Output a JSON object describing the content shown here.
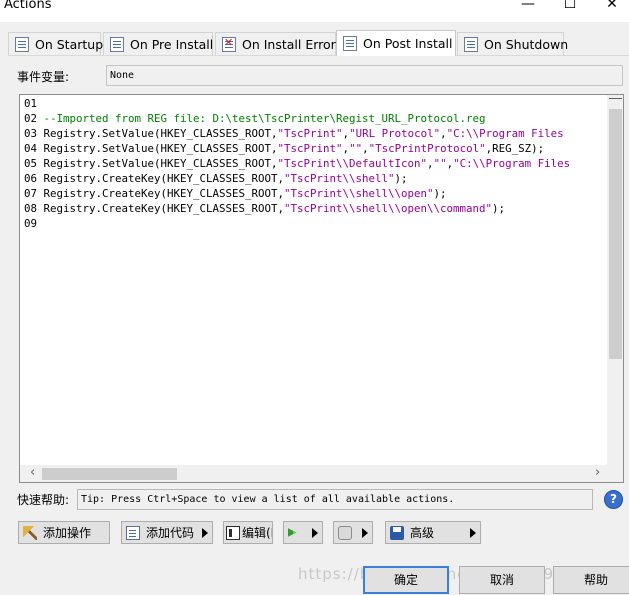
{
  "window": {
    "title": "Actions",
    "minimize_glyph": "—",
    "maximize_glyph": "☐",
    "close_glyph": "✕"
  },
  "tabs": [
    {
      "label": "On Startup",
      "icon": "script-icon",
      "active": false
    },
    {
      "label": "On Pre Install",
      "icon": "script-icon",
      "active": false
    },
    {
      "label": "On Install Error",
      "icon": "script-error-icon",
      "active": false
    },
    {
      "label": "On Post Install",
      "icon": "script-icon",
      "active": true
    },
    {
      "label": "On Shutdown",
      "icon": "script-icon",
      "active": false
    }
  ],
  "event": {
    "label": "事件变量:",
    "value": "None"
  },
  "editor": {
    "lines": [
      {
        "num": "01",
        "parts": []
      },
      {
        "num": "02",
        "parts": [
          {
            "t": "--Imported from REG file: D:\\test\\TscPrinter\\Regist_URL_Protocol.reg",
            "c": "comment"
          }
        ]
      },
      {
        "num": "03",
        "parts": [
          {
            "t": "Registry.SetValue(HKEY_CLASSES_ROOT,",
            "c": "plain"
          },
          {
            "t": "\"TscPrint\"",
            "c": "str"
          },
          {
            "t": ",",
            "c": "plain"
          },
          {
            "t": "\"URL Protocol\"",
            "c": "str"
          },
          {
            "t": ",",
            "c": "plain"
          },
          {
            "t": "\"C:\\\\Program Files",
            "c": "str"
          }
        ]
      },
      {
        "num": "04",
        "parts": [
          {
            "t": "Registry.SetValue(HKEY_CLASSES_ROOT,",
            "c": "plain"
          },
          {
            "t": "\"TscPrint\"",
            "c": "str"
          },
          {
            "t": ",",
            "c": "plain"
          },
          {
            "t": "\"\"",
            "c": "str"
          },
          {
            "t": ",",
            "c": "plain"
          },
          {
            "t": "\"TscPrintProtocol\"",
            "c": "str"
          },
          {
            "t": ",REG_SZ);",
            "c": "plain"
          }
        ]
      },
      {
        "num": "05",
        "parts": [
          {
            "t": "Registry.SetValue(HKEY_CLASSES_ROOT,",
            "c": "plain"
          },
          {
            "t": "\"TscPrint\\\\DefaultIcon\"",
            "c": "str"
          },
          {
            "t": ",",
            "c": "plain"
          },
          {
            "t": "\"\"",
            "c": "str"
          },
          {
            "t": ",",
            "c": "plain"
          },
          {
            "t": "\"C:\\\\Program Files",
            "c": "str"
          }
        ]
      },
      {
        "num": "06",
        "parts": [
          {
            "t": "Registry.CreateKey(HKEY_CLASSES_ROOT,",
            "c": "plain"
          },
          {
            "t": "\"TscPrint\\\\shell\"",
            "c": "str"
          },
          {
            "t": ");",
            "c": "plain"
          }
        ]
      },
      {
        "num": "07",
        "parts": [
          {
            "t": "Registry.CreateKey(HKEY_CLASSES_ROOT,",
            "c": "plain"
          },
          {
            "t": "\"TscPrint\\\\shell\\\\open\"",
            "c": "str"
          },
          {
            "t": ");",
            "c": "plain"
          }
        ]
      },
      {
        "num": "08",
        "parts": [
          {
            "t": "Registry.CreateKey(HKEY_CLASSES_ROOT,",
            "c": "plain"
          },
          {
            "t": "\"TscPrint\\\\shell\\\\open\\\\command\"",
            "c": "str"
          },
          {
            "t": ");",
            "c": "plain"
          }
        ]
      },
      {
        "num": "09",
        "parts": []
      }
    ]
  },
  "quick_help": {
    "label": "快速帮助:",
    "text": "Tip: Press Ctrl+Space to view a list of all available actions."
  },
  "toolbar": {
    "add_action": "添加操作",
    "add_code": "添加代码",
    "edit": "编辑(E",
    "advanced": "高级"
  },
  "buttons": {
    "ok": "确定",
    "cancel": "取消",
    "help": "帮助"
  },
  "watermark": "https://blog.csdn.net/u010189178",
  "colors": {
    "comment": "#008000",
    "string": "#990099",
    "accent": "#3c7fd8"
  }
}
